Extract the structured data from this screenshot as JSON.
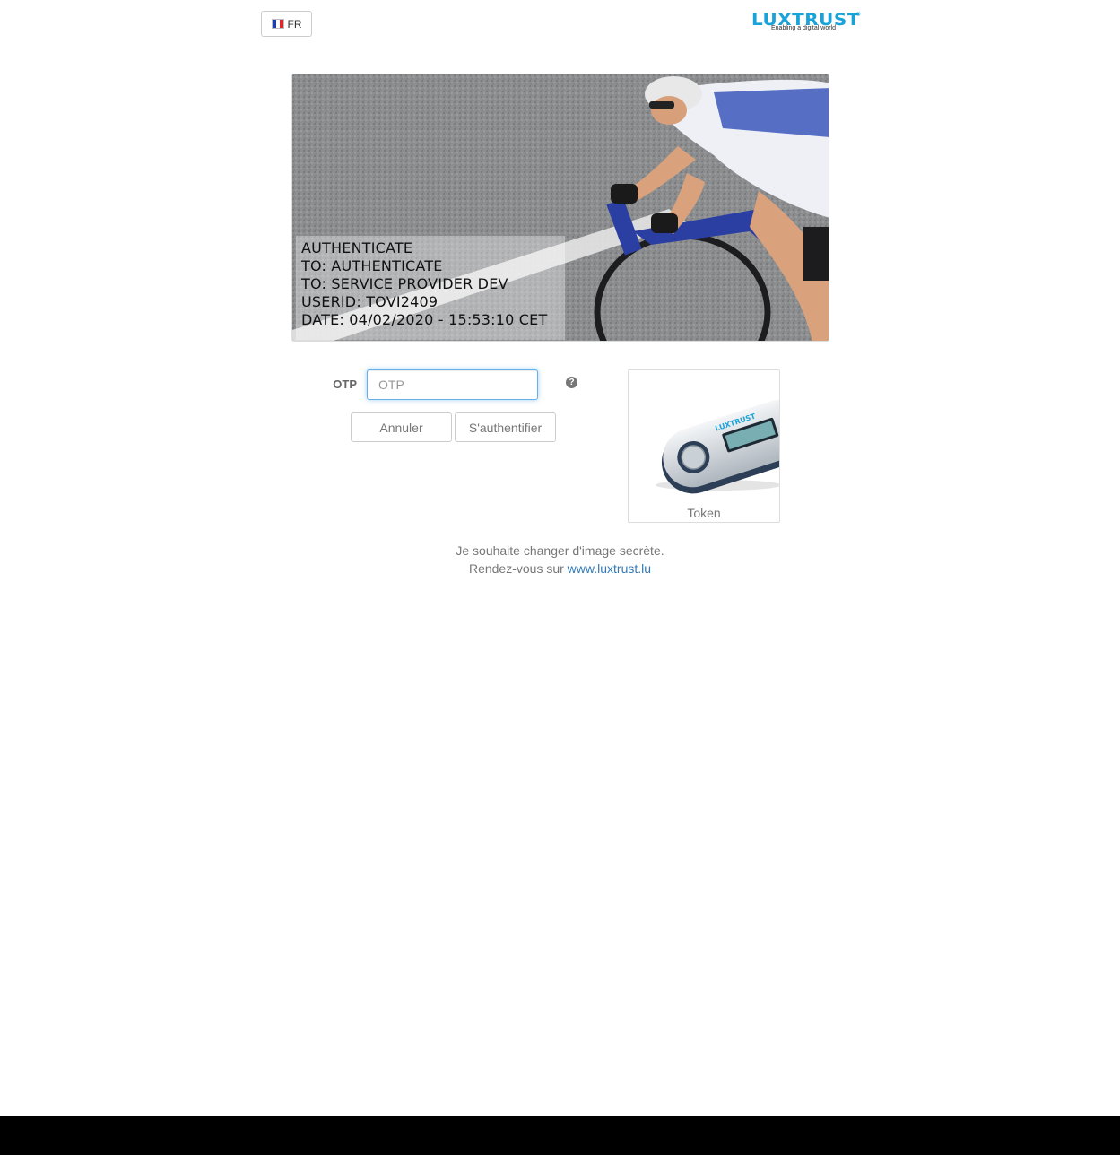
{
  "header": {
    "language": {
      "code": "FR",
      "flag_icon": "france-flag-icon",
      "flag_colors": [
        "#1f3fa8",
        "#ffffff",
        "#e0262a"
      ]
    },
    "logo": {
      "text": "LUXTRUST",
      "tagline": "Enabling a digital world",
      "mark": "®",
      "color": "#1aa3d9"
    }
  },
  "secret_image": {
    "description_icon": "cyclist-photo",
    "lines": [
      "AUTHENTICATE",
      "TO: AUTHENTICATE",
      "TO: SERVICE PROVIDER DEV",
      "USERID: TOVI2409",
      "DATE: 04/02/2020 - 15:53:10 CET"
    ]
  },
  "form": {
    "otp_label": "OTP",
    "otp_placeholder": "OTP",
    "otp_value": "",
    "help_icon": "question-circle-icon",
    "cancel_label": "Annuler",
    "submit_label": "S'authentifier"
  },
  "token_card": {
    "label": "Token",
    "brand": "LUXTRUST",
    "icon": "token-device-icon"
  },
  "footer": {
    "line1": "Je souhaite changer d'image secrète.",
    "line2_prefix": "Rendez-vous sur",
    "link_text": "www.luxtrust.lu"
  },
  "colors": {
    "accent": "#1aa3d9",
    "link": "#337ab7",
    "focus": "#66afe9"
  }
}
